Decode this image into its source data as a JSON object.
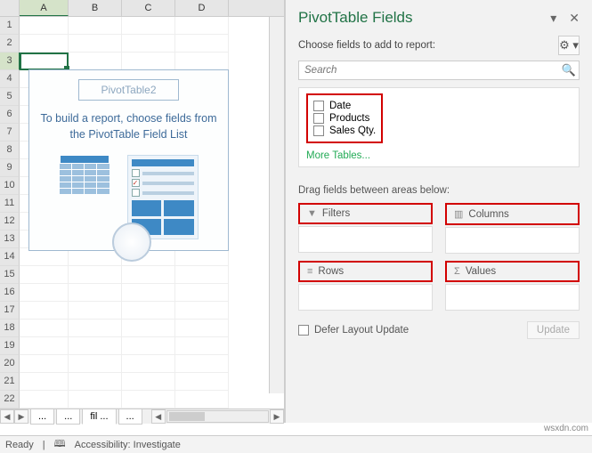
{
  "grid": {
    "columns": [
      "A",
      "B",
      "C",
      "D"
    ],
    "rows": [
      1,
      2,
      3,
      4,
      5,
      6,
      7,
      8,
      9,
      10,
      11,
      12,
      13,
      14,
      15,
      16,
      17,
      18,
      19,
      20,
      21,
      22
    ],
    "active_cell": "A3",
    "tabs": [
      "...",
      "...",
      "fil ...",
      "..."
    ],
    "placeholder": {
      "title": "PivotTable2",
      "message": "To build a report, choose fields from the PivotTable Field List"
    }
  },
  "pane": {
    "title": "PivotTable Fields",
    "subtitle": "Choose fields to add to report:",
    "search_placeholder": "Search",
    "fields": [
      "Date",
      "Products",
      "Sales Qty."
    ],
    "more": "More Tables...",
    "drag_label": "Drag fields between areas below:",
    "areas": {
      "filters": "Filters",
      "columns": "Columns",
      "rows": "Rows",
      "values": "Values"
    },
    "defer": "Defer Layout Update",
    "update": "Update"
  },
  "status": {
    "ready": "Ready",
    "acc": "Accessibility: Investigate"
  },
  "watermark": "wsxdn.com"
}
